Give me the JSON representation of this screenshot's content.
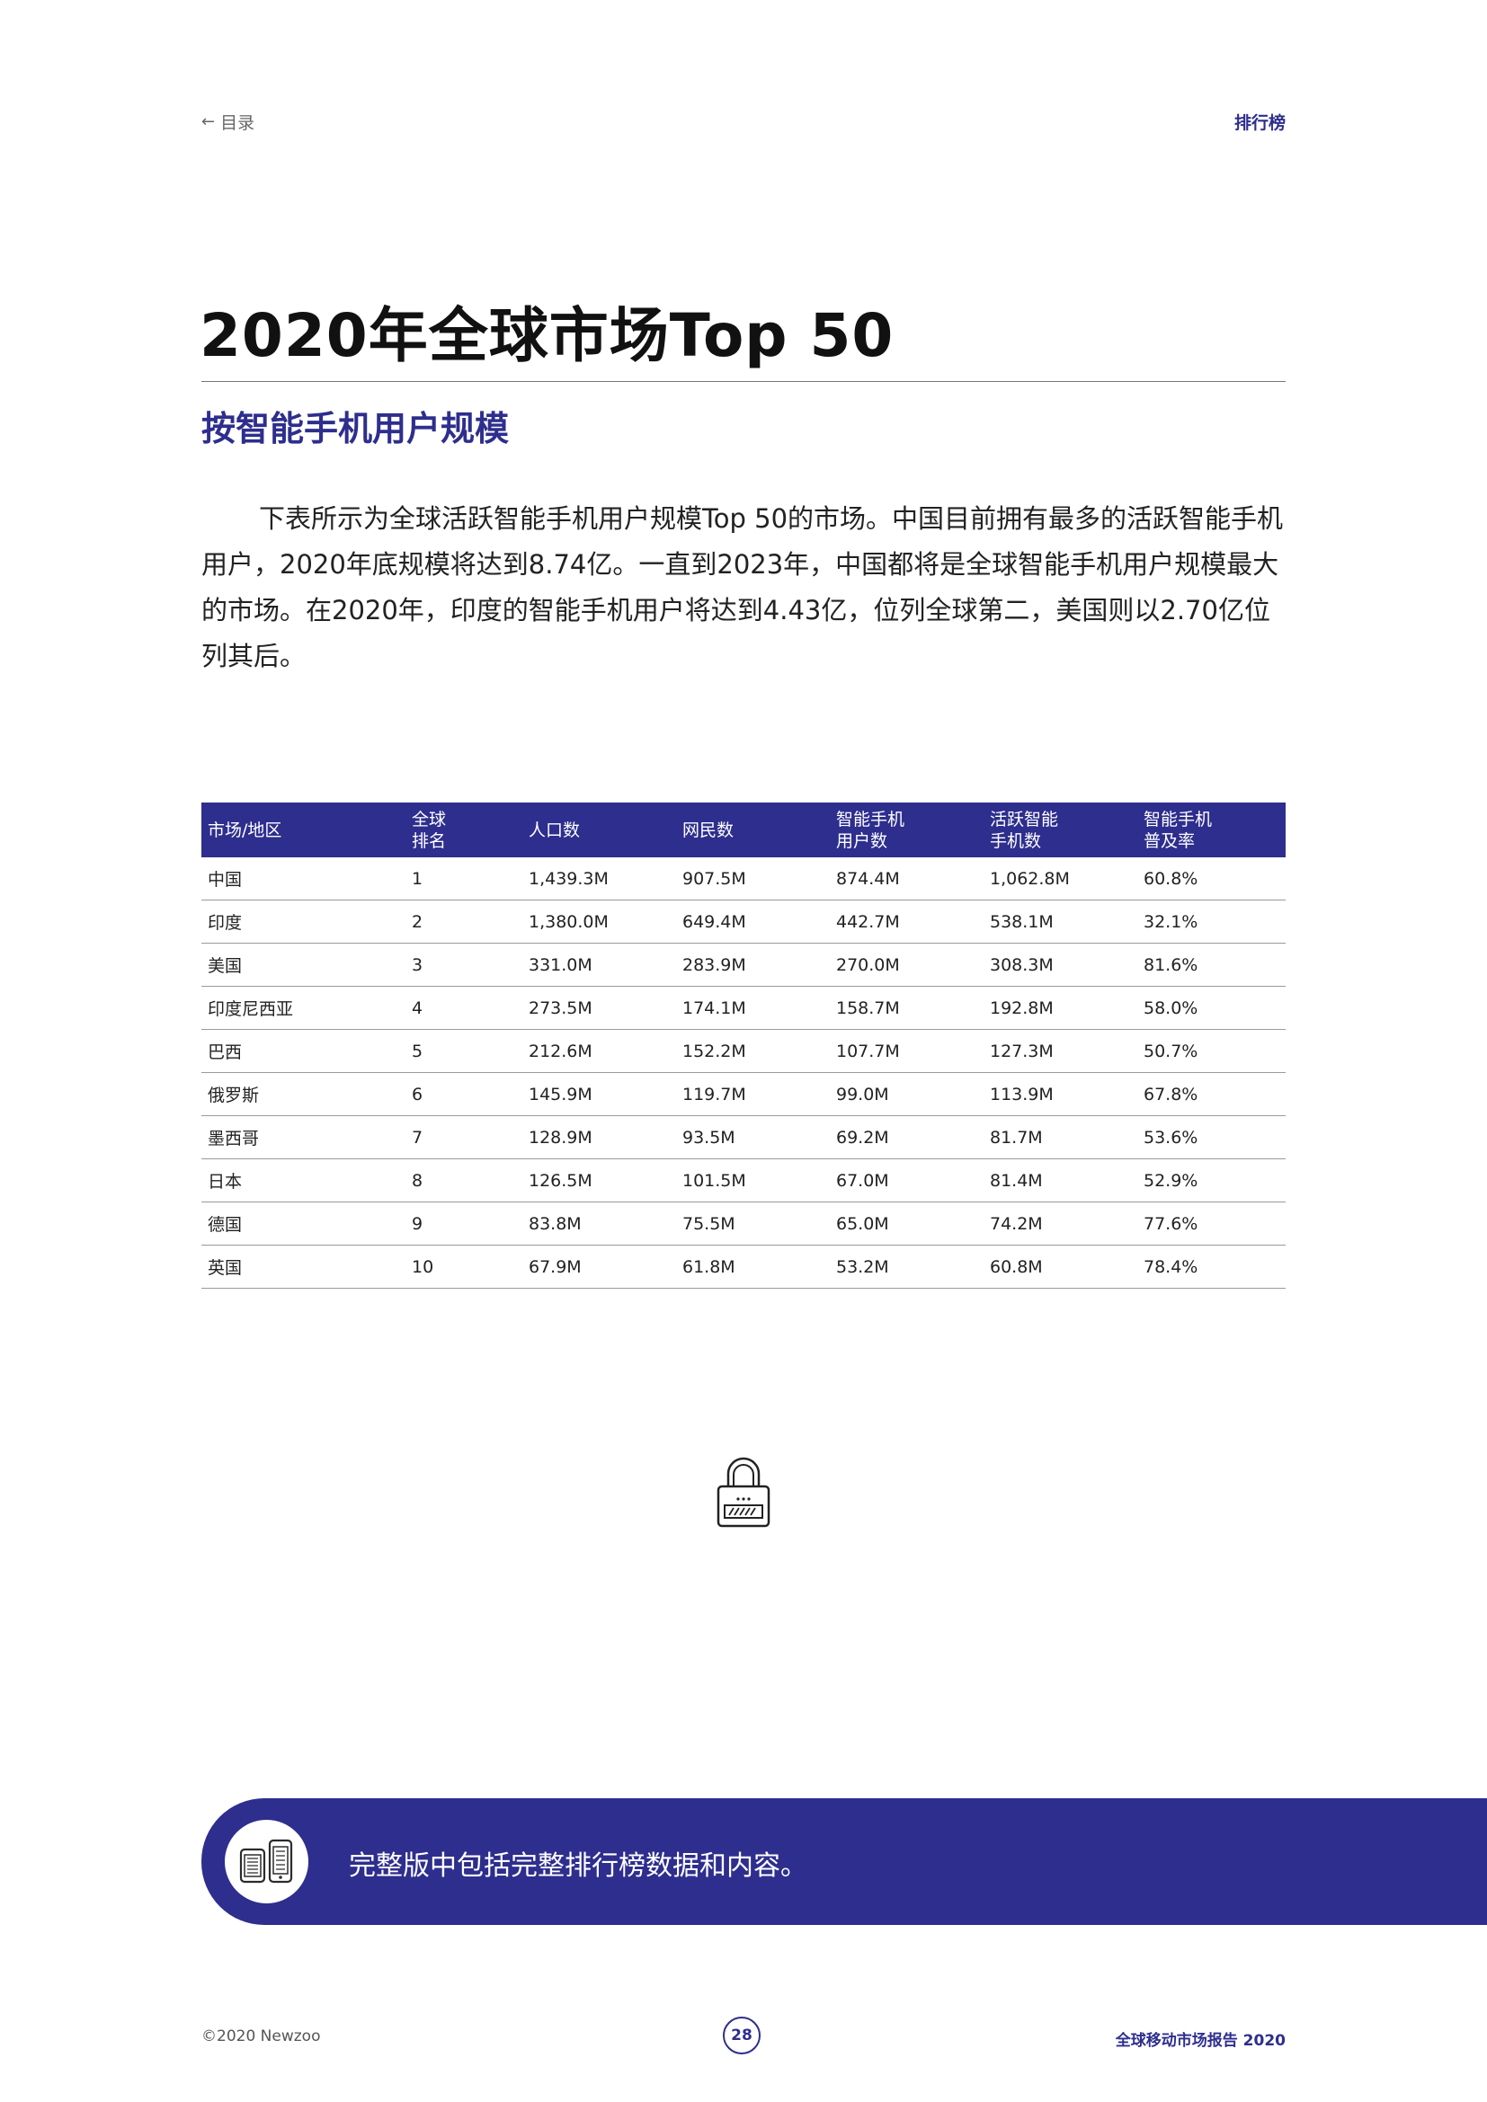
{
  "header": {
    "back_arrow": "←",
    "back_label": "目录",
    "section_tag": "排行榜"
  },
  "title": "2020年全球市场Top 50",
  "subtitle": "按智能手机用户规模",
  "intro": "下表所示为全球活跃智能手机用户规模Top 50的市场。中国目前拥有最多的活跃智能手机用户，2020年底规模将达到8.74亿。一直到2023年，中国都将是全球智能手机用户规模最大的市场。在2020年，印度的智能手机用户将达到4.43亿，位列全球第二，美国则以2.70亿位列其后。",
  "table": {
    "columns": [
      [
        "市场/地区"
      ],
      [
        "全球",
        "排名"
      ],
      [
        "人口数"
      ],
      [
        "网民数"
      ],
      [
        "智能手机",
        "用户数"
      ],
      [
        "活跃智能",
        "手机数"
      ],
      [
        "智能手机",
        "普及率"
      ]
    ],
    "rows": [
      [
        "中国",
        "1",
        "1,439.3M",
        "907.5M",
        "874.4M",
        "1,062.8M",
        "60.8%"
      ],
      [
        "印度",
        "2",
        "1,380.0M",
        "649.4M",
        "442.7M",
        "538.1M",
        "32.1%"
      ],
      [
        "美国",
        "3",
        "331.0M",
        "283.9M",
        "270.0M",
        "308.3M",
        "81.6%"
      ],
      [
        "印度尼西亚",
        "4",
        "273.5M",
        "174.1M",
        "158.7M",
        "192.8M",
        "58.0%"
      ],
      [
        "巴西",
        "5",
        "212.6M",
        "152.2M",
        "107.7M",
        "127.3M",
        "50.7%"
      ],
      [
        "俄罗斯",
        "6",
        "145.9M",
        "119.7M",
        "99.0M",
        "113.9M",
        "67.8%"
      ],
      [
        "墨西哥",
        "7",
        "128.9M",
        "93.5M",
        "69.2M",
        "81.7M",
        "53.6%"
      ],
      [
        "日本",
        "8",
        "126.5M",
        "101.5M",
        "67.0M",
        "81.4M",
        "52.9%"
      ],
      [
        "德国",
        "9",
        "83.8M",
        "75.5M",
        "65.0M",
        "74.2M",
        "77.6%"
      ],
      [
        "英国",
        "10",
        "67.9M",
        "61.8M",
        "53.2M",
        "60.8M",
        "78.4%"
      ]
    ]
  },
  "banner": {
    "text": "完整版中包括完整排行榜数据和内容。"
  },
  "footer": {
    "copyright": "©2020 Newzoo",
    "page_number": "28",
    "report_title": "全球移动市场报告 2020"
  },
  "icons": {
    "lock": "lock-icon",
    "devices": "mobile-devices-icon",
    "back": "arrow-left-icon"
  },
  "colors": {
    "accent": "#2e2e8e",
    "text": "#222222",
    "rule": "#9a9a9a"
  }
}
